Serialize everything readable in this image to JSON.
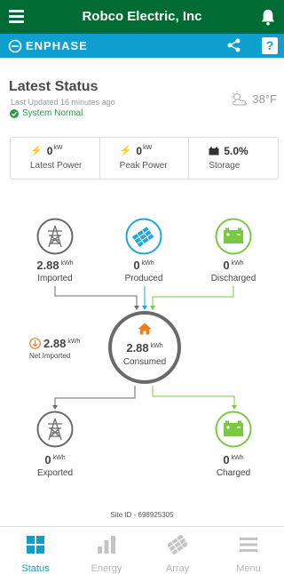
{
  "header": {
    "title": "Robco Electric, Inc"
  },
  "brand": {
    "name": "ENPHASE"
  },
  "status": {
    "title": "Latest Status",
    "last_updated": "Last Updated 16 minutes ago",
    "system_state": "System Normal",
    "temperature": "38°F"
  },
  "stats": [
    {
      "value": "0",
      "unit": "kW",
      "label": "Latest Power",
      "icon": "bolt-icon"
    },
    {
      "value": "0",
      "unit": "kW",
      "label": "Peak Power",
      "icon": "bolt-icon"
    },
    {
      "value": "5.0%",
      "unit": "",
      "label": "Storage",
      "icon": "battery-icon"
    }
  ],
  "flow": {
    "imported": {
      "value": "2.88",
      "unit": "kWh",
      "label": "Imported"
    },
    "produced": {
      "value": "0",
      "unit": "kWh",
      "label": "Produced"
    },
    "discharged": {
      "value": "0",
      "unit": "kWh",
      "label": "Discharged"
    },
    "net_imported": {
      "value": "2.88",
      "unit": "kWh",
      "label": "Net Imported"
    },
    "consumed": {
      "value": "2.88",
      "unit": "kWh",
      "label": "Consumed"
    },
    "exported": {
      "value": "0",
      "unit": "kWh",
      "label": "Exported"
    },
    "charged": {
      "value": "0",
      "unit": "kWh",
      "label": "Charged"
    }
  },
  "site": {
    "id_text": "Site ID - 698925305"
  },
  "nav": [
    {
      "label": "Status",
      "icon": "status-grid-icon",
      "active": true
    },
    {
      "label": "Energy",
      "icon": "bar-chart-icon",
      "active": false
    },
    {
      "label": "Array",
      "icon": "array-panels-icon",
      "active": false
    },
    {
      "label": "Menu",
      "icon": "menu-lines-icon",
      "active": false
    }
  ],
  "colors": {
    "header_green": "#006b32",
    "brand_blue": "#0d9fce",
    "grid_gray": "#6a6a6a",
    "solar_blue": "#1ea7dc",
    "battery_green": "#7ac943",
    "home_orange": "#f07c1a",
    "normal_green": "#2c9a4a"
  }
}
